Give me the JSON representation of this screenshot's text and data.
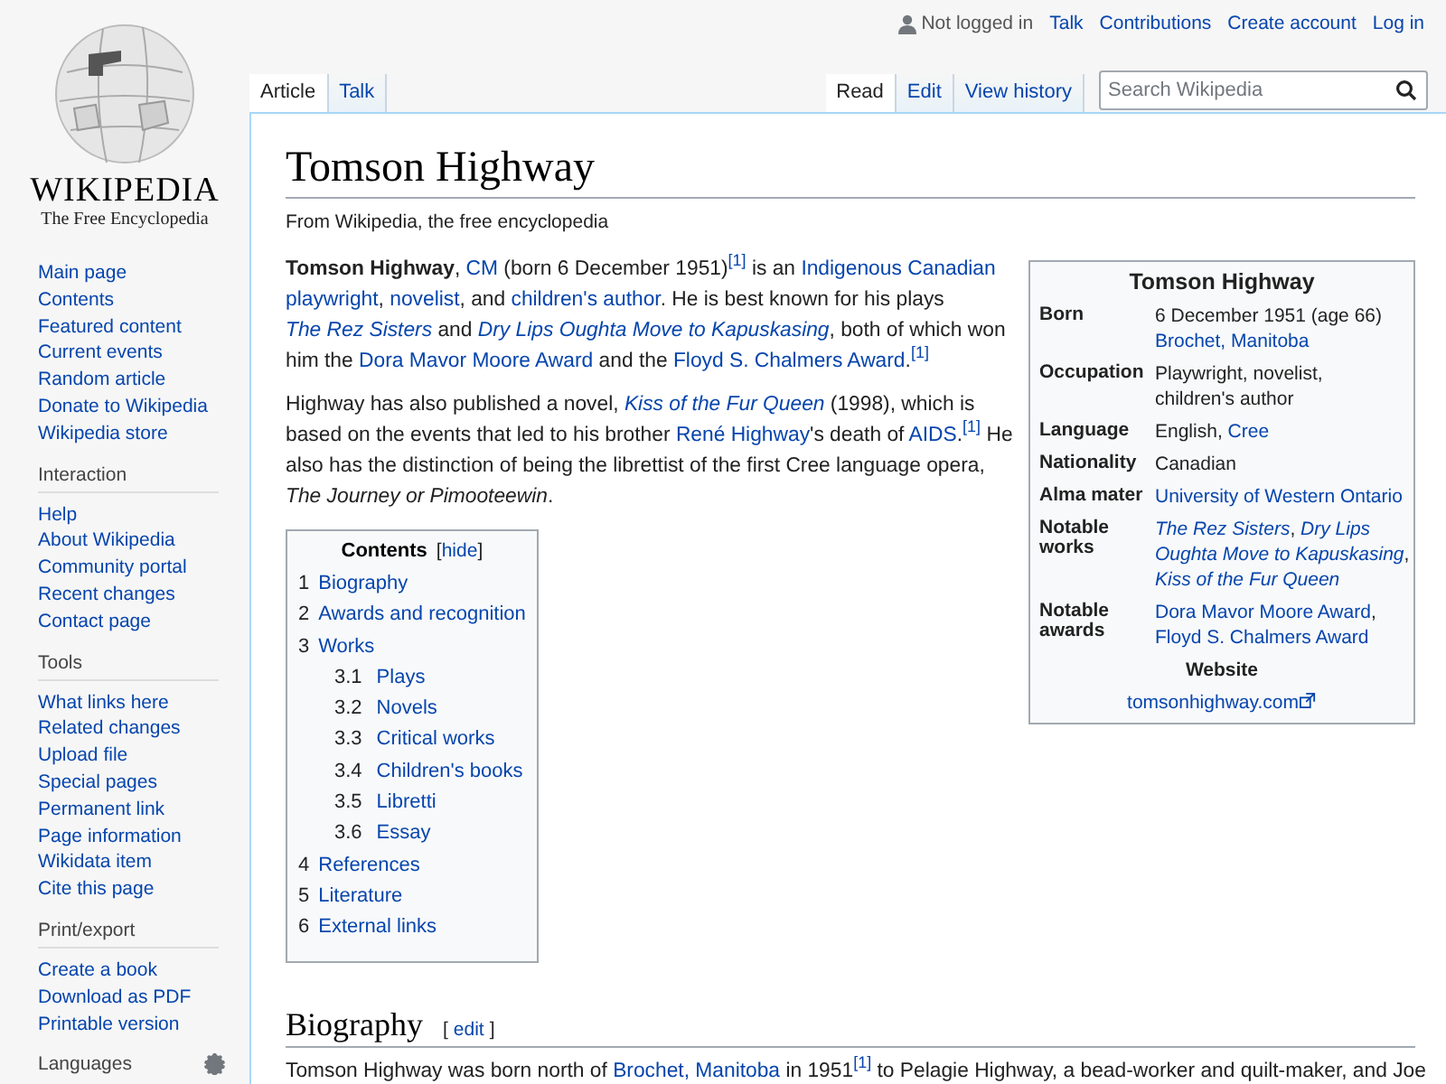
{
  "logo": {
    "wordmark": "WIKIPEDIA",
    "tagline": "The Free Encyclopedia"
  },
  "personal": {
    "status": "Not logged in",
    "links": [
      "Talk",
      "Contributions",
      "Create account",
      "Log in"
    ]
  },
  "tabs_left": [
    {
      "label": "Article",
      "selected": true
    },
    {
      "label": "Talk",
      "selected": false
    }
  ],
  "tabs_right": [
    {
      "label": "Read",
      "selected": true
    },
    {
      "label": "Edit",
      "selected": false
    },
    {
      "label": "View history",
      "selected": false
    }
  ],
  "search": {
    "placeholder": "Search Wikipedia"
  },
  "sidebar": [
    {
      "items": [
        "Main page",
        "Contents",
        "Featured content",
        "Current events",
        "Random article",
        "Donate to Wikipedia",
        "Wikipedia store"
      ]
    },
    {
      "heading": "Interaction",
      "items": [
        "Help",
        "About Wikipedia",
        "Community portal",
        "Recent changes",
        "Contact page"
      ]
    },
    {
      "heading": "Tools",
      "items": [
        "What links here",
        "Related changes",
        "Upload file",
        "Special pages",
        "Permanent link",
        "Page information",
        "Wikidata item",
        "Cite this page"
      ]
    },
    {
      "heading": "Print/export",
      "items": [
        "Create a book",
        "Download as PDF",
        "Printable version"
      ]
    },
    {
      "heading": "Languages",
      "settings": true
    }
  ],
  "title": "Tomson Highway",
  "tagline": "From Wikipedia, the free encyclopedia",
  "intro": [
    [
      {
        "kind": "bold",
        "text": "Tomson Highway"
      },
      {
        "kind": "text",
        "text": ", "
      },
      {
        "kind": "link",
        "text": "CM"
      },
      {
        "kind": "text",
        "text": " (born 6 December 1951)"
      },
      {
        "kind": "ref",
        "text": "[1]"
      },
      {
        "kind": "text",
        "text": " is an "
      },
      {
        "kind": "link",
        "text": "Indigenous Canadian"
      },
      {
        "kind": "space"
      },
      {
        "kind": "link",
        "text": "playwright"
      },
      {
        "kind": "text",
        "text": ", "
      },
      {
        "kind": "link",
        "text": "novelist"
      },
      {
        "kind": "text",
        "text": ", and "
      },
      {
        "kind": "link",
        "text": "children's author"
      },
      {
        "kind": "text",
        "text": ". He is best known for his plays "
      },
      {
        "kind": "link",
        "text": "*The Rez*"
      },
      {
        "kind": "space"
      },
      {
        "kind": "link",
        "text": "*Sisters*"
      },
      {
        "kind": "text",
        "text": " and "
      },
      {
        "kind": "link",
        "text": "*Dry Lips Oughta Move to Kapuskasing*"
      },
      {
        "kind": "text",
        "text": ", both of which won him the "
      },
      {
        "kind": "link",
        "text": "Dora Mavor Moore Award"
      },
      {
        "kind": "text",
        "text": " and the "
      },
      {
        "kind": "link",
        "text": "Floyd S. Chalmers Award"
      },
      {
        "kind": "text",
        "text": "."
      },
      {
        "kind": "ref",
        "text": "[1]"
      }
    ],
    [
      {
        "kind": "text",
        "text": "Highway has also published a novel, "
      },
      {
        "kind": "link",
        "text": "*Kiss of the Fur Queen*"
      },
      {
        "kind": "text",
        "text": " (1998), which is based on the events that led to his brother "
      },
      {
        "kind": "link",
        "text": "René Highway"
      },
      {
        "kind": "text",
        "text": "'s death of "
      },
      {
        "kind": "link",
        "text": "AIDS"
      },
      {
        "kind": "text",
        "text": "."
      },
      {
        "kind": "ref",
        "text": "[1]"
      },
      {
        "kind": "text",
        "text": " He also has the distinction of being the librettist of the first Cree language opera, *The Journey or Pimooteewin*."
      }
    ]
  ],
  "infobox": {
    "title": "Tomson Highway",
    "rows": [
      {
        "label": "Born",
        "value": [
          {
            "kind": "text",
            "text": "6 December 1951 (age 66)"
          },
          {
            "kind": "break"
          },
          {
            "kind": "link",
            "text": "Brochet, Manitoba"
          }
        ]
      },
      {
        "label": "Occupation",
        "value": [
          {
            "kind": "text",
            "text": "Playwright, novelist, children's author"
          }
        ]
      },
      {
        "label": "Language",
        "value": [
          {
            "kind": "text",
            "text": "English,"
          },
          {
            "kind": "space"
          },
          {
            "kind": "link",
            "text": "Cree"
          }
        ]
      },
      {
        "label": "Nationality",
        "value": [
          {
            "kind": "text",
            "text": "Canadian"
          }
        ]
      },
      {
        "label": "Alma mater",
        "value": [
          {
            "kind": "link",
            "text": "University of Western Ontario"
          }
        ]
      },
      {
        "label": "Notable works",
        "value": [
          {
            "kind": "link",
            "text": "*The Rez Sisters*"
          },
          {
            "kind": "text",
            "text": ","
          },
          {
            "kind": "space"
          },
          {
            "kind": "link",
            "text": "*Dry Lips*"
          },
          {
            "kind": "space"
          },
          {
            "kind": "link",
            "text": "*Oughta Move to Kapuskasing*"
          },
          {
            "kind": "text",
            "text": ","
          },
          {
            "kind": "space"
          },
          {
            "kind": "link",
            "text": "*Kiss of the Fur Queen*"
          }
        ]
      },
      {
        "label": "Notable awards",
        "value": [
          {
            "kind": "link",
            "text": "Dora Mavor Moore Award"
          },
          {
            "kind": "text",
            "text": ","
          },
          {
            "kind": "space"
          },
          {
            "kind": "link",
            "text": "Floyd S. Chalmers Award"
          }
        ]
      }
    ],
    "website_heading": "Website",
    "website": "tomsonhighway.com"
  },
  "toc": {
    "title": "Contents",
    "bracket_open": "[",
    "toggle": "hide",
    "bracket_close": "]",
    "items": [
      {
        "number": "1",
        "label": "Biography"
      },
      {
        "number": "2",
        "label": "Awards and recognition"
      },
      {
        "number": "3",
        "label": "Works",
        "children": [
          {
            "number": "3.1",
            "label": "Plays"
          },
          {
            "number": "3.2",
            "label": "Novels"
          },
          {
            "number": "3.3",
            "label": "Critical works"
          },
          {
            "number": "3.4",
            "label": "Children's books"
          },
          {
            "number": "3.5",
            "label": "Libretti"
          },
          {
            "number": "3.6",
            "label": "Essay"
          }
        ]
      },
      {
        "number": "4",
        "label": "References"
      },
      {
        "number": "5",
        "label": "Literature"
      },
      {
        "number": "6",
        "label": "External links"
      }
    ]
  },
  "section": {
    "heading": "Biography",
    "bracket_open": "[",
    "edit": "edit",
    "bracket_close": "]",
    "paragraph": [
      {
        "kind": "text",
        "text": "Tomson Highway was born north of "
      },
      {
        "kind": "link",
        "text": "Brochet, Manitoba"
      },
      {
        "kind": "text",
        "text": " in 1951"
      },
      {
        "kind": "ref",
        "text": "[1]"
      },
      {
        "kind": "text",
        "text": " to Pelagie Highway, a bead-worker and quilt-maker, and Joe"
      }
    ]
  }
}
